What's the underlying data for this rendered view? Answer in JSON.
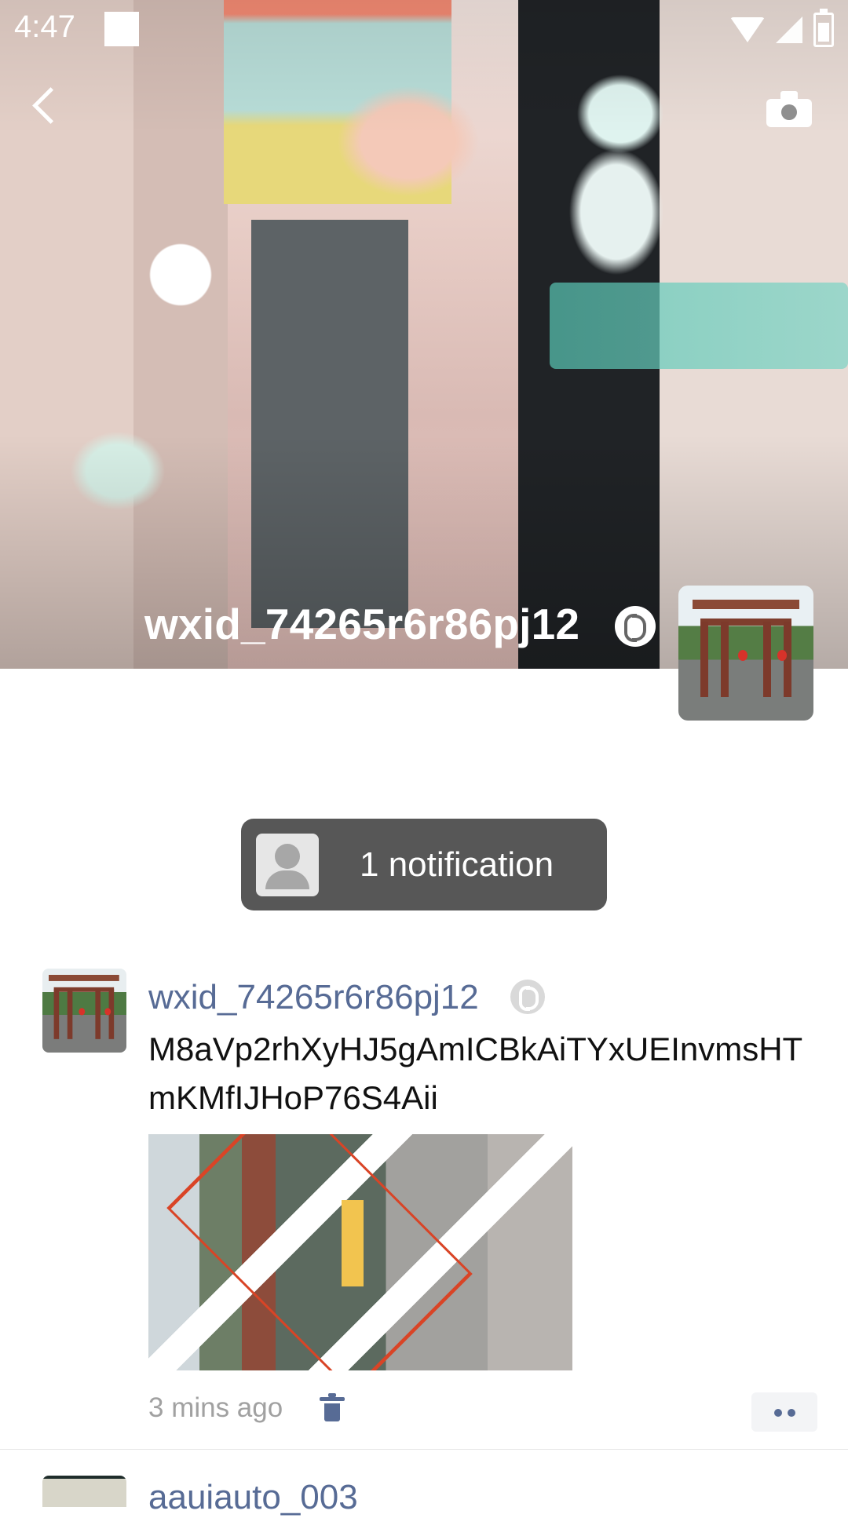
{
  "statusbar": {
    "time": "4:47"
  },
  "profile": {
    "name": "wxid_74265r6r86pj12"
  },
  "notification": {
    "text": "1 notification"
  },
  "post": {
    "author": "wxid_74265r6r86pj12",
    "text": "M8aVp2rhXyHJ5gAmICBkAiTYxUEInvmsHTmKMfIJHoP76S4Aii",
    "time": "3 mins ago"
  },
  "next_post": {
    "author": "aauiauto_003"
  },
  "icons": {
    "back": "back-chevron-icon",
    "camera": "camera-icon",
    "verified": "verified-badge-icon",
    "trash": "trash-icon",
    "more": "more-actions-icon"
  },
  "colors": {
    "link_blue": "#576b95",
    "pill_bg": "#575757",
    "time_gray": "#a1a1a1"
  }
}
